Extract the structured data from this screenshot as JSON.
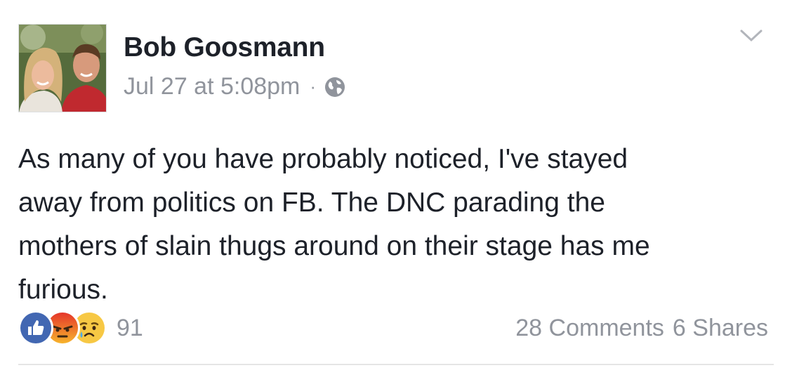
{
  "post": {
    "author": "Bob Goosmann",
    "timestamp": "Jul 27 at 5:08pm",
    "separator": "·",
    "privacy_icon": "globe-icon",
    "menu_icon": "chevron-down-icon",
    "text": "As many of you have probably noticed, I've stayed\naway from politics on FB. The DNC parading the\nmothers of slain thugs around on their stage has me\nfurious."
  },
  "footer": {
    "reactions": [
      "like-icon",
      "angry-icon",
      "sad-icon"
    ],
    "reaction_count": "91",
    "comments": "28 Comments",
    "shares": "6 Shares"
  },
  "colors": {
    "text": "#1d2129",
    "muted": "#90949c",
    "like": "#4267b2",
    "angry": "#e9710f",
    "sad": "#f7c844"
  }
}
